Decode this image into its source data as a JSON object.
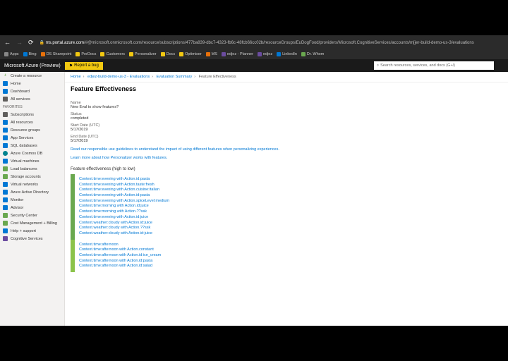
{
  "browser": {
    "url_host": "ms.portal.azure.com",
    "url_path": "/#@microsoft.onmicrosoft.com/resource/subscriptions/477ba839-dbc7-4323-fb6c-48fcb66cc02b/resourceGroups/EuDogFood/providers/Microsoft.CognitiveServices/accounts/m[jer-build-demo-us-3/evaluations"
  },
  "bookmarks": [
    {
      "label": "Apps"
    },
    {
      "label": "Bing"
    },
    {
      "label": "DS Sharepoint"
    },
    {
      "label": "PerDocs"
    },
    {
      "label": "Customers"
    },
    {
      "label": "Personalizer"
    },
    {
      "label": "Docs"
    },
    {
      "label": "Optimiser"
    },
    {
      "label": "MS"
    },
    {
      "label": "edjez - Planner"
    },
    {
      "label": "edjez"
    },
    {
      "label": "LinkedIn"
    },
    {
      "label": "Dr. Whom"
    }
  ],
  "azure": {
    "logo": "Microsoft Azure (Preview)",
    "report": "Report a bug",
    "search_placeholder": "Search resources, services, and docs (G+/)"
  },
  "sidebar": {
    "create": "Create a resource",
    "home": "Home",
    "dashboard": "Dashboard",
    "allservices": "All services",
    "favorites": "FAVORITES",
    "items": [
      "Subscriptions",
      "All resources",
      "Resource groups",
      "App Services",
      "SQL databases",
      "Azure Cosmos DB",
      "Virtual machines",
      "Load balancers",
      "Storage accounts",
      "Virtual networks",
      "Azure Active Directory",
      "Monitor",
      "Advisor",
      "Security Center",
      "Cost Management + Billing",
      "Help + support",
      "Cognitive Services"
    ]
  },
  "breadcrumb": {
    "home": "Home",
    "acct": "edjez-build-demo-us-3 - Evaluations",
    "eval": "Evaluation Summary",
    "current": "Feature Effectiveness"
  },
  "page": {
    "title": "Feature Effectiveness",
    "name_lbl": "Name",
    "name_val": "New Eval to show features?",
    "status_lbl": "Status",
    "status_val": "completed",
    "start_lbl": "Start Date (UTC)",
    "start_val": "5/17/2019",
    "end_lbl": "End Date (UTC)",
    "end_val": "5/17/2019",
    "link1": "Read our responsible use guidelines to understand the impact of using different features when personalizing experiences.",
    "link2": "Learn more about how Personalizer works with features.",
    "section": "Feature effectiveness (high to low)"
  },
  "features_g1": [
    "Context.time:evening with Action.id:pasta",
    "Context.time:evening with Action.taste:fresh",
    "Context.time:evening with Action.cuisine:italian",
    "Context.time:evening with Action.id:pasta",
    "Context.time:evening with Action.spiceLevel:medium",
    "Context.time:morning with Action.id:juice",
    "Context.time:morning with Action.??ssk",
    "Context.time:evening with Action.id:juice",
    "Context.weather:cloudy with Action.id:juice",
    "Context.weather:cloudy with Action.??ssk",
    "Context.weather:cloudy with Action.id:juice"
  ],
  "features_g2": [
    "Context.time:afternoon",
    "Context.time:afternoon with Action.constant",
    "Context.time:afternoon with Action.id:ice_cream",
    "Context.time:afternoon with Action.id:pasta",
    "Context.time:afternoon with Action.id:salad"
  ]
}
